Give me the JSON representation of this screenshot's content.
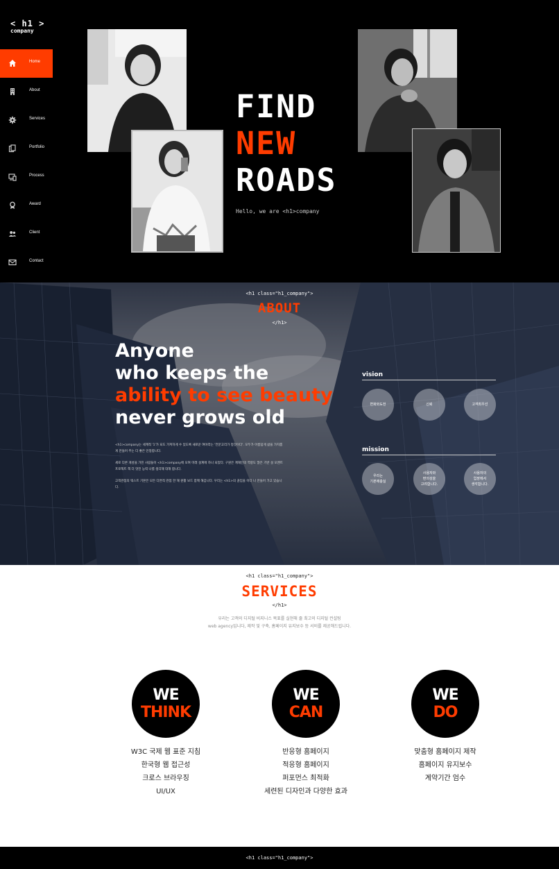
{
  "logo": {
    "line1": "< h1 >",
    "line2": "company"
  },
  "nav": [
    {
      "label": "Home",
      "icon": "home-icon",
      "active": true
    },
    {
      "label": "About",
      "icon": "building-icon"
    },
    {
      "label": "Services",
      "icon": "gear-icon"
    },
    {
      "label": "Portfolio",
      "icon": "copy-icon"
    },
    {
      "label": "Process",
      "icon": "devices-icon"
    },
    {
      "label": "Award",
      "icon": "award-icon"
    },
    {
      "label": "Client",
      "icon": "users-icon"
    },
    {
      "label": "Contact",
      "icon": "envelope-icon"
    }
  ],
  "hero": {
    "line1": "FIND",
    "line2": "NEW",
    "line3": "ROADS",
    "subtitle": "Hello, we are <h1>company"
  },
  "about": {
    "code_open": "<h1 class=\"h1_company\">",
    "title": "ABOUT",
    "code_close": "</h1>",
    "head1": "Anyone",
    "head2": "who keeps the",
    "head3": "ability to see beauty",
    "head4": "never grows old",
    "para1": "<h1>company는 세계적 '1'가 되도 가져하게 수 있도록 새로운 여야라는 '전문고리가 정것이다'. 모두가 아름답게 삶을 가치롭게 만들어 주는 더 좋은 인정합니다.",
    "para2": "세로 다른 개성을 가진 사람들이 <h1>company에 모여 미래 설계에 하나 되었다. 구원은 계재인의 역량도 많은 기반 설 모멘트 프로젝트 책 더 멋진 능력 나를 생각해 대해 합니다.",
    "para3": "고객관점의 텍스트 기본은 모든 다면적 관점 한 해 원활 보드 함께 해갑니다. 우리는 <h1>의 끊임을 이다 나 만들어 가고 있습니다.",
    "vision_title": "vision",
    "vision_items": [
      "변화와도전",
      "신뢰",
      "고객최우선"
    ],
    "mission_title": "mission",
    "mission_items": [
      "우리는\n기본에충실",
      "사용자와\n편의성을\n고려합니다.",
      "사용자의\n입장에서\n생각합니다."
    ]
  },
  "services": {
    "code_open": "<h1 class=\"h1_company\">",
    "title": "SERVICES",
    "code_close": "</h1>",
    "desc1": "우리는 고객의 디지털 비지니스 목표를 실현해 줄 최고의 디지털 컨설팅",
    "desc2": "web agency입니다, 제작 및 구축, 홈페이지 유지보수 등 서비를 제공해드립니다.",
    "cards": [
      {
        "we": "WE",
        "word": "THINK",
        "items": [
          "W3C 국제 웹 표준 지침",
          "한국형 웹 접근성",
          "크로스 브라우징",
          "UI/UX"
        ]
      },
      {
        "we": "WE",
        "word": "CAN",
        "items": [
          "반응형 홈페이지",
          "적응형 홈페이지",
          "퍼포먼스 최적화",
          "세련된 디자인과 다양한 효과"
        ]
      },
      {
        "we": "WE",
        "word": "DO",
        "items": [
          "맞춤형 홈페이지 제작",
          "홈페이지 유지보수",
          "계약기간 엄수"
        ]
      }
    ]
  },
  "footer": {
    "code_open": "<h1 class=\"h1_company\">"
  },
  "colors": {
    "accent": "#ff3c00",
    "dark": "#000000"
  }
}
